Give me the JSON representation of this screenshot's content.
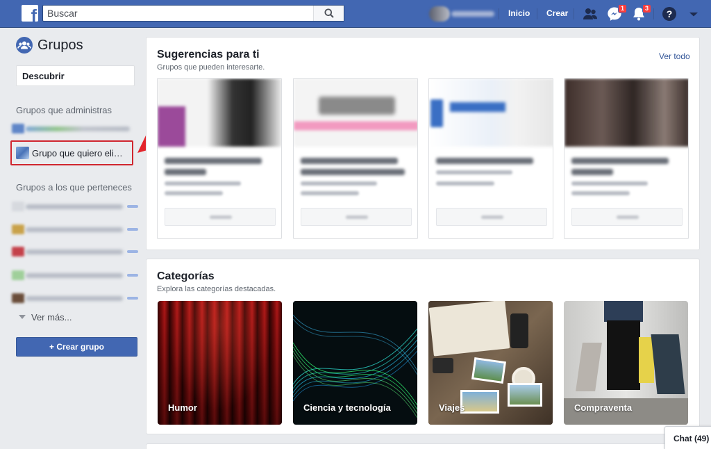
{
  "header": {
    "search_placeholder": "Buscar",
    "home_label": "Inicio",
    "create_label": "Crear",
    "messages_badge": "1",
    "notifications_badge": "3"
  },
  "sidebar": {
    "title": "Grupos",
    "discover_label": "Descubrir",
    "admin_section": "Grupos que administras",
    "highlighted_group": "Grupo que quiero eli…",
    "member_section": "Grupos a los que perteneces",
    "see_more": "Ver más...",
    "create_group": "+ Crear grupo"
  },
  "suggestions": {
    "title": "Sugerencias para ti",
    "subtitle": "Grupos que pueden interesarte.",
    "see_all": "Ver todo"
  },
  "categories": {
    "title": "Categorías",
    "subtitle": "Explora las categorías destacadas.",
    "items": [
      {
        "label": "Humor"
      },
      {
        "label": "Ciencia y tecnología"
      },
      {
        "label": "Viajes"
      },
      {
        "label": "Compraventa"
      }
    ]
  },
  "chat": {
    "label": "Chat (49)"
  },
  "colors": {
    "brand": "#4267b2",
    "highlight": "#d0262f",
    "badge": "#fa3e3e"
  }
}
